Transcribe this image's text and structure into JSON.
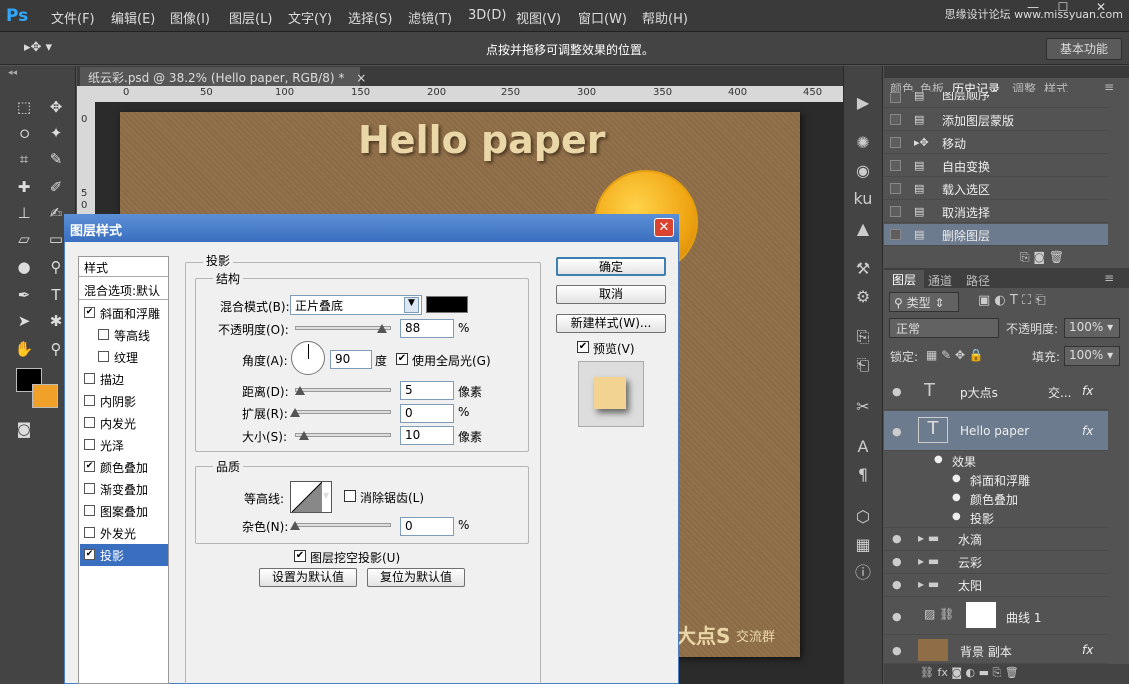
{
  "app": {
    "logo": "Ps",
    "watermark": "思缘设计论坛 www.missyuan.com",
    "win_min": "—",
    "win_max": "☐",
    "win_close": "✕"
  },
  "menu": [
    "文件(F)",
    "编辑(E)",
    "图像(I)",
    "图层(L)",
    "文字(Y)",
    "选择(S)",
    "滤镜(T)",
    "3D(D)",
    "视图(V)",
    "窗口(W)",
    "帮助(H)"
  ],
  "options": {
    "hint": "点按并拖移可调整效果的位置。",
    "workspace": "基本功能"
  },
  "document": {
    "tab_title": "纸云彩.psd @ 38.2% (Hello paper, RGB/8) *",
    "tab_close": "×",
    "ruler_ticks": [
      "0",
      "50",
      "100",
      "150",
      "200",
      "250",
      "300",
      "350",
      "400",
      "450"
    ],
    "ruler_left": [
      "0",
      "5",
      "0"
    ],
    "canvas_text": "Hello paper",
    "canvas_text2": "大点S",
    "canvas_text3": "交流群"
  },
  "colors": {
    "fg": "#000000",
    "bg": "#f0a12a"
  },
  "history": {
    "tabs": [
      "颜色",
      "色板",
      "历史记录",
      "调整",
      "样式"
    ],
    "items": [
      "图层顺序",
      "添加图层蒙版",
      "移动",
      "自由变换",
      "载入选区",
      "取消选择",
      "删除图层"
    ]
  },
  "layers": {
    "tabs": [
      "图层",
      "通道",
      "路径"
    ],
    "filter_kind": "类型",
    "blend_mode": "正常",
    "opacity_label": "不透明度:",
    "opacity": "100%",
    "lock_label": "锁定:",
    "fill_label": "填充:",
    "fill": "100%",
    "rows": [
      "p大点s",
      "Hello paper",
      "效果",
      "斜面和浮雕",
      "颜色叠加",
      "投影",
      "水滴",
      "云彩",
      "太阳",
      "曲线 1",
      "背景 副本"
    ],
    "row0_extra": "交...",
    "fx": "fx"
  },
  "dialog": {
    "title": "图层样式",
    "close": "✕",
    "styles_header": "样式",
    "blend_options": "混合选项:默认",
    "styles": [
      {
        "label": "斜面和浮雕",
        "checked": true
      },
      {
        "label": "等高线",
        "checked": false
      },
      {
        "label": "纹理",
        "checked": false
      },
      {
        "label": "描边",
        "checked": false
      },
      {
        "label": "内阴影",
        "checked": false
      },
      {
        "label": "内发光",
        "checked": false
      },
      {
        "label": "光泽",
        "checked": false
      },
      {
        "label": "颜色叠加",
        "checked": true
      },
      {
        "label": "渐变叠加",
        "checked": false
      },
      {
        "label": "图案叠加",
        "checked": false
      },
      {
        "label": "外发光",
        "checked": false
      },
      {
        "label": "投影",
        "checked": true
      }
    ],
    "section": "投影",
    "structure": "结构",
    "blend_mode_label": "混合模式(B):",
    "blend_mode": "正片叠底",
    "blend_color": "#000000",
    "opacity_label": "不透明度(O):",
    "opacity": "88",
    "pct": "%",
    "angle_label": "角度(A):",
    "angle": "90",
    "deg": "度",
    "global_light": "使用全局光(G)",
    "distance_label": "距离(D):",
    "distance": "5",
    "px": "像素",
    "spread_label": "扩展(R):",
    "spread": "0",
    "size_label": "大小(S):",
    "size": "10",
    "quality": "品质",
    "contour_label": "等高线:",
    "antialias": "消除锯齿(L)",
    "noise_label": "杂色(N):",
    "noise": "0",
    "knockout": "图层挖空投影(U)",
    "make_default": "设置为默认值",
    "reset_default": "复位为默认值",
    "ok": "确定",
    "cancel": "取消",
    "new_style": "新建样式(W)...",
    "preview": "预览(V)"
  }
}
